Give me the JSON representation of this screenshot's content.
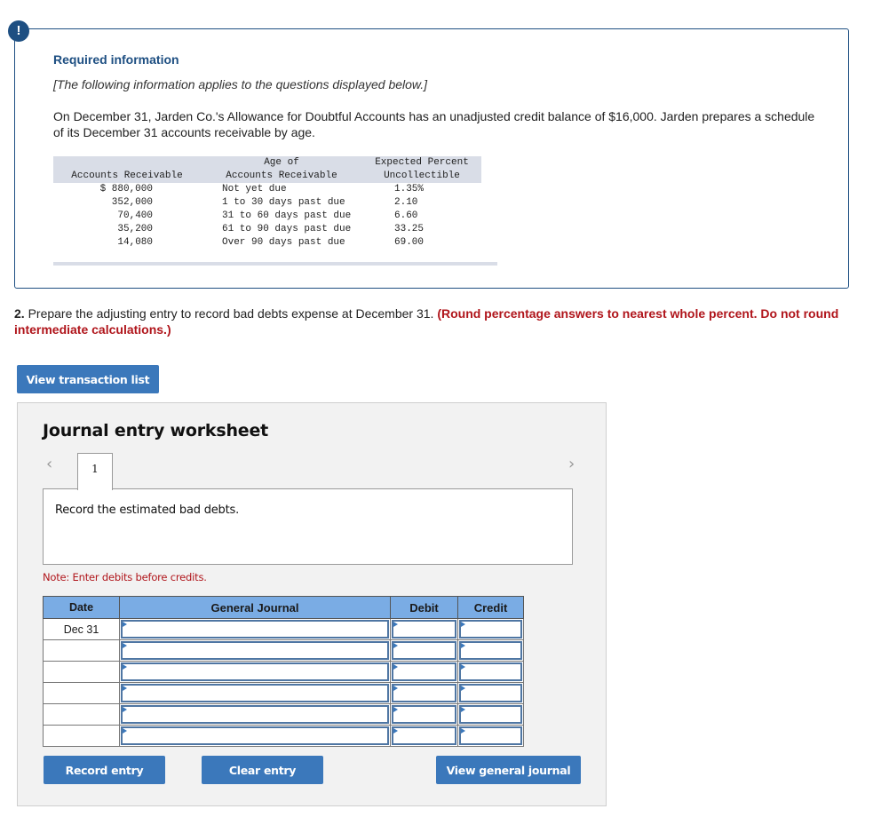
{
  "alert": {
    "icon": "!"
  },
  "required_info": {
    "title": "Required information",
    "subtitle": "[The following information applies to the questions displayed below.]",
    "paragraph": "On December 31, Jarden Co.'s Allowance for Doubtful Accounts has an unadjusted credit balance of $16,000. Jarden prepares a schedule of its December 31 accounts receivable by age."
  },
  "aging_schedule": {
    "headers": [
      {
        "line1": "",
        "line2": "Accounts Receivable"
      },
      {
        "line1": "Age of",
        "line2": "Accounts Receivable"
      },
      {
        "line1": "Expected Percent",
        "line2": "Uncollectible"
      }
    ],
    "rows": [
      {
        "amount": "$ 880,000",
        "age": "Not yet due",
        "percent": "1.35%"
      },
      {
        "amount": "352,000",
        "age": "1 to 30 days past due",
        "percent": "2.10"
      },
      {
        "amount": "70,400",
        "age": "31 to 60 days past due",
        "percent": "6.60"
      },
      {
        "amount": "35,200",
        "age": "61 to 90 days past due",
        "percent": "33.25"
      },
      {
        "amount": "14,080",
        "age": "Over 90 days past due",
        "percent": "69.00"
      }
    ]
  },
  "question": {
    "number": "2.",
    "text": " Prepare the adjusting entry to record bad debts expense at December 31. ",
    "instruction": "(Round percentage answers to nearest whole percent. Do not round intermediate calculations.)"
  },
  "buttons": {
    "view_transaction_list": "View transaction list",
    "record_entry": "Record entry",
    "clear_entry": "Clear entry",
    "view_general_journal": "View general journal"
  },
  "worksheet": {
    "title": "Journal entry worksheet",
    "prev_icon": "‹",
    "next_icon": "›",
    "tabs": [
      {
        "label": "1"
      }
    ],
    "description": "Record the estimated bad debts.",
    "note": "Note: Enter debits before credits.",
    "columns": {
      "date": "Date",
      "general_journal": "General Journal",
      "debit": "Debit",
      "credit": "Credit"
    },
    "rows": [
      {
        "date": "Dec 31",
        "account": "",
        "debit": "",
        "credit": ""
      },
      {
        "date": "",
        "account": "",
        "debit": "",
        "credit": ""
      },
      {
        "date": "",
        "account": "",
        "debit": "",
        "credit": ""
      },
      {
        "date": "",
        "account": "",
        "debit": "",
        "credit": ""
      },
      {
        "date": "",
        "account": "",
        "debit": "",
        "credit": ""
      },
      {
        "date": "",
        "account": "",
        "debit": "",
        "credit": ""
      }
    ]
  }
}
